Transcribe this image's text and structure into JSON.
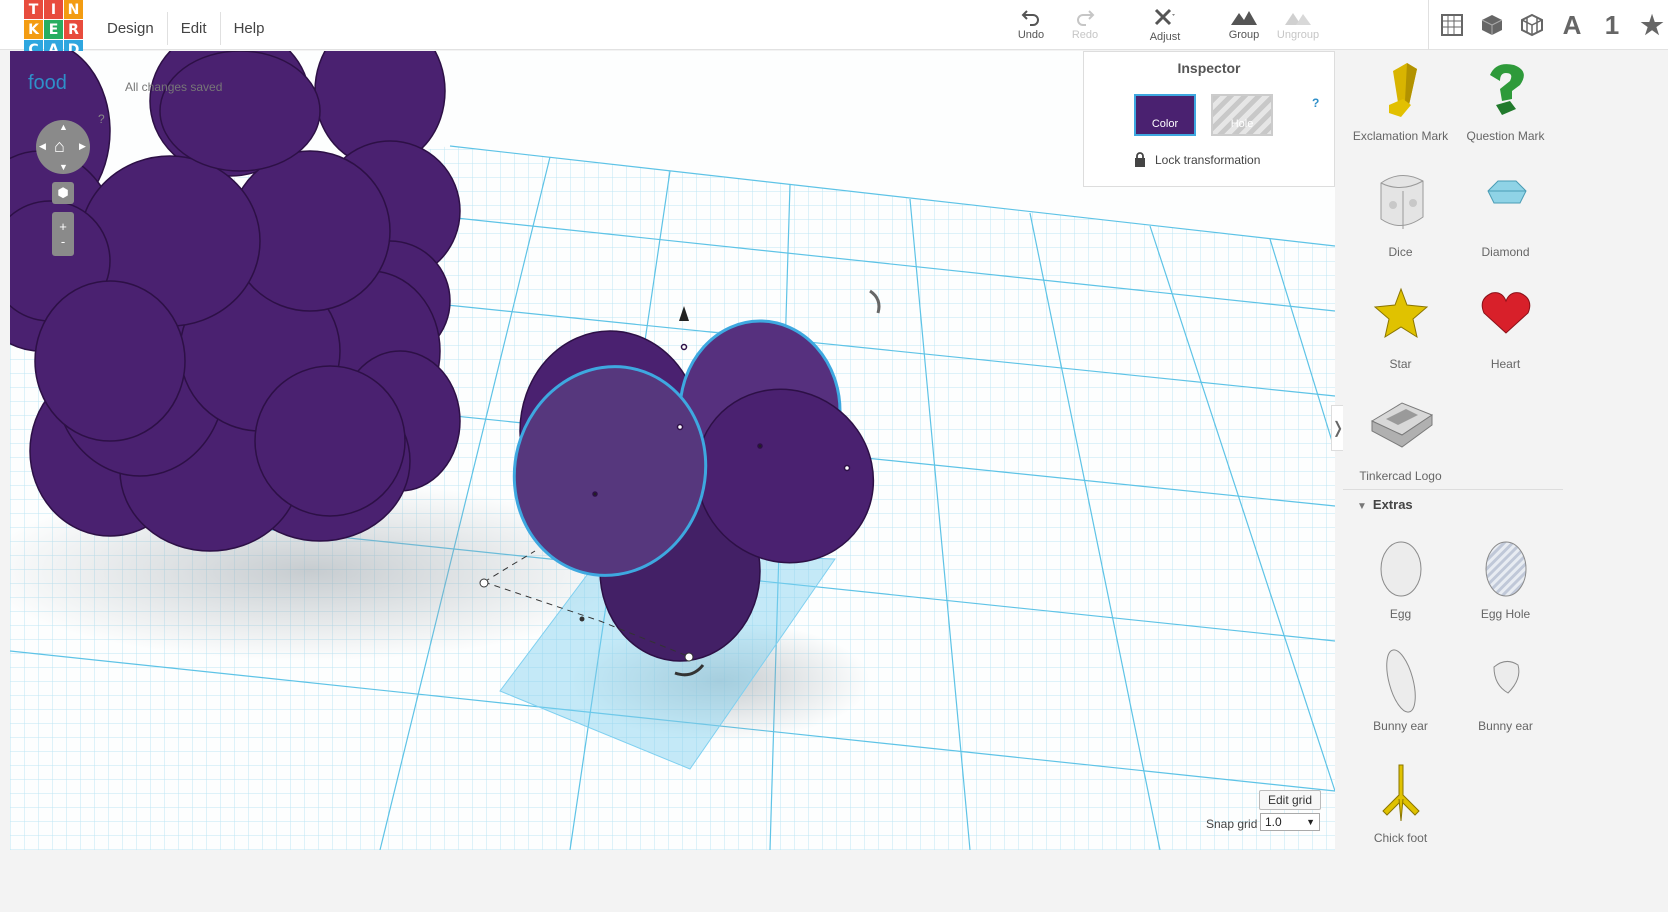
{
  "logo": {
    "letters": [
      "T",
      "I",
      "N",
      "K",
      "E",
      "R",
      "C",
      "A",
      "D"
    ],
    "colors": [
      "#e84c3d",
      "#e84c3d",
      "#f39c12",
      "#f39c12",
      "#27ae60",
      "#e84c3d",
      "#2ea6df",
      "#2ea6df",
      "#2ea6df"
    ]
  },
  "menu": [
    "Design",
    "Edit",
    "Help"
  ],
  "toolbar": {
    "undo": "Undo",
    "redo": "Redo",
    "adjust": "Adjust",
    "group": "Group",
    "ungroup": "Ungroup"
  },
  "view_icons": {
    "letter": "A",
    "number": "1"
  },
  "project": {
    "title": "food",
    "save_status": "All changes saved"
  },
  "nav": {
    "help": "?",
    "zoom_in": "+",
    "zoom_out": "-"
  },
  "inspector": {
    "title": "Inspector",
    "color_label": "Color",
    "hole_label": "Hole",
    "help": "?",
    "lock_label": "Lock transformation"
  },
  "shapes": [
    {
      "label": "Exclamation Mark"
    },
    {
      "label": "Question Mark"
    },
    {
      "label": "Dice"
    },
    {
      "label": "Diamond"
    },
    {
      "label": "Star"
    },
    {
      "label": "Heart"
    },
    {
      "label": "Tinkercad Logo"
    }
  ],
  "extras": {
    "header": "Extras",
    "shapes": [
      {
        "label": "Egg"
      },
      {
        "label": "Egg Hole"
      },
      {
        "label": "Bunny ear"
      },
      {
        "label": "Bunny ear"
      },
      {
        "label": "Chick foot"
      }
    ]
  },
  "grid": {
    "edit_label": "Edit grid",
    "snap_label": "Snap grid",
    "snap_value": "1.0"
  },
  "colors": {
    "accent": "#2f8fc9",
    "object": "#4a2170",
    "grid": "#8fd4ee",
    "selection": "#3ea8e0"
  }
}
